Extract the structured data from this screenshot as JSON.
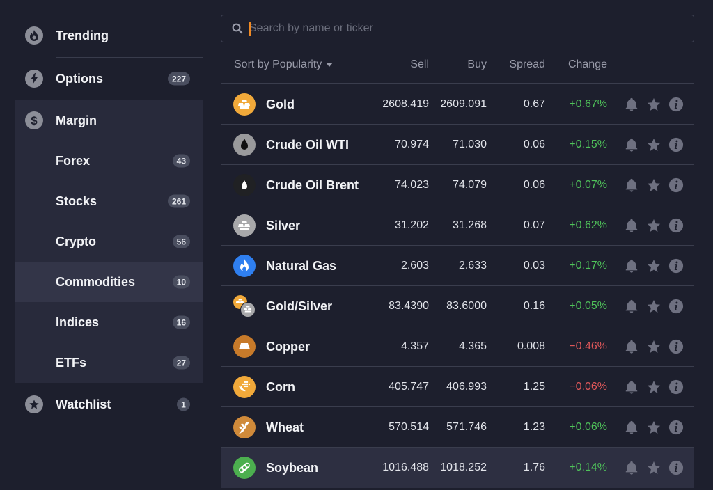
{
  "sidebar": {
    "items": [
      {
        "label": "Trending",
        "icon": "flame-icon"
      },
      {
        "label": "Options",
        "icon": "lightning-icon",
        "count": "227"
      },
      {
        "label": "Margin",
        "icon": "dollar-icon"
      },
      {
        "label": "Forex",
        "count": "43"
      },
      {
        "label": "Stocks",
        "count": "261"
      },
      {
        "label": "Crypto",
        "count": "56"
      },
      {
        "label": "Commodities",
        "count": "10",
        "active": true
      },
      {
        "label": "Indices",
        "count": "16"
      },
      {
        "label": "ETFs",
        "count": "27"
      },
      {
        "label": "Watchlist",
        "icon": "star-icon",
        "count": "1"
      }
    ]
  },
  "search": {
    "placeholder": "Search by name or ticker",
    "value": ""
  },
  "table": {
    "sort_label": "Sort by Popularity",
    "columns": {
      "sell": "Sell",
      "buy": "Buy",
      "spread": "Spread",
      "change": "Change"
    },
    "rows": [
      {
        "name": "Gold",
        "icon": "gold-bars-icon",
        "sell": "2608.419",
        "buy": "2609.091",
        "spread": "0.67",
        "change": "+0.67%",
        "dir": "up"
      },
      {
        "name": "Crude Oil WTI",
        "icon": "oil-drop-icon",
        "sell": "70.974",
        "buy": "71.030",
        "spread": "0.06",
        "change": "+0.15%",
        "dir": "up"
      },
      {
        "name": "Crude Oil Brent",
        "icon": "oil-drop-icon",
        "sell": "74.023",
        "buy": "74.079",
        "spread": "0.06",
        "change": "+0.07%",
        "dir": "up"
      },
      {
        "name": "Silver",
        "icon": "silver-bars-icon",
        "sell": "31.202",
        "buy": "31.268",
        "spread": "0.07",
        "change": "+0.62%",
        "dir": "up"
      },
      {
        "name": "Natural Gas",
        "icon": "flame-icon",
        "sell": "2.603",
        "buy": "2.633",
        "spread": "0.03",
        "change": "+0.17%",
        "dir": "up"
      },
      {
        "name": "Gold/Silver",
        "icon": "gold-silver-icon",
        "sell": "83.4390",
        "buy": "83.6000",
        "spread": "0.16",
        "change": "+0.05%",
        "dir": "up"
      },
      {
        "name": "Copper",
        "icon": "copper-bar-icon",
        "sell": "4.357",
        "buy": "4.365",
        "spread": "0.008",
        "change": "−0.46%",
        "dir": "down"
      },
      {
        "name": "Corn",
        "icon": "corn-icon",
        "sell": "405.747",
        "buy": "406.993",
        "spread": "1.25",
        "change": "−0.06%",
        "dir": "down"
      },
      {
        "name": "Wheat",
        "icon": "wheat-icon",
        "sell": "570.514",
        "buy": "571.746",
        "spread": "1.23",
        "change": "+0.06%",
        "dir": "up"
      },
      {
        "name": "Soybean",
        "icon": "soybean-icon",
        "sell": "1016.488",
        "buy": "1018.252",
        "spread": "1.76",
        "change": "+0.14%",
        "dir": "up"
      }
    ]
  },
  "colors": {
    "positive": "#4fc25a",
    "negative": "#e0585a",
    "accent": "#f08a24"
  }
}
